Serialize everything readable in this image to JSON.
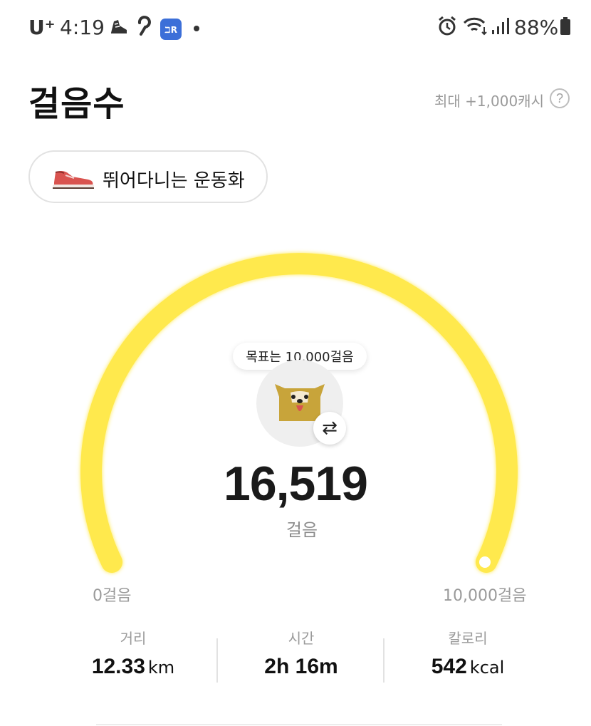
{
  "status_bar": {
    "carrier": "U⁺",
    "time": "4:19",
    "battery": "88%",
    "icons": [
      "sneaker-icon",
      "hook-icon",
      "app-badge-icon",
      "dot-icon",
      "alarm-icon",
      "wifi-icon",
      "signal-icon",
      "battery-icon"
    ],
    "app_badge_text": "ℶR"
  },
  "header": {
    "title": "걸음수",
    "max_cash": "최대 +1,000캐시",
    "help_icon": "?"
  },
  "shoe_chip": {
    "label": "뛰어다니는 운동화",
    "icon": "sneaker-icon"
  },
  "gauge": {
    "goal_tooltip": "목표는 10,000걸음",
    "steps": "16,519",
    "unit": "걸음",
    "scale_min": "0걸음",
    "scale_max": "10,000걸음",
    "progress": 1.0,
    "track_color": "#FFE94D",
    "swap_icon": "⇄"
  },
  "stats": [
    {
      "label": "거리",
      "value": "12.33",
      "unit": "km"
    },
    {
      "label": "시간",
      "value": "2h 16m",
      "unit": ""
    },
    {
      "label": "칼로리",
      "value": "542",
      "unit": "kcal"
    }
  ]
}
